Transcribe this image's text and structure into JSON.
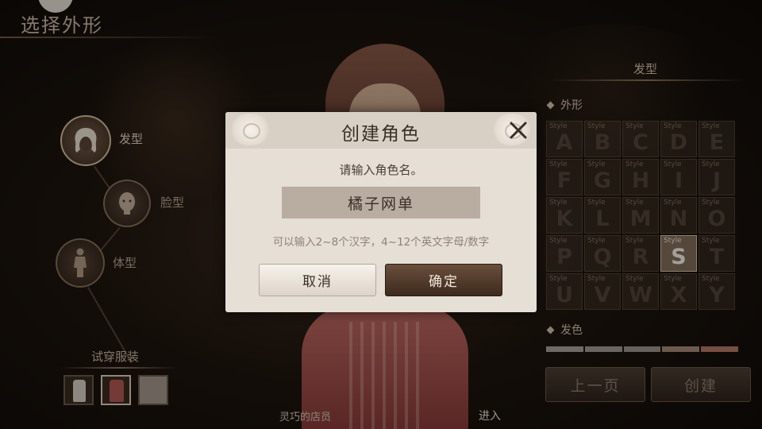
{
  "screen": {
    "title": "选择外形",
    "nav": {
      "hair_label": "发型",
      "face_label": "脸型",
      "body_label": "体型"
    },
    "outfit": {
      "title": "试穿服装"
    },
    "right_panel": {
      "heading": "发型",
      "section_appearance": "外形",
      "section_hair_color": "发色",
      "style_caption": "Style",
      "styles": [
        "A",
        "B",
        "C",
        "D",
        "E",
        "F",
        "G",
        "H",
        "I",
        "J",
        "K",
        "L",
        "M",
        "N",
        "O",
        "P",
        "Q",
        "R",
        "S",
        "T",
        "U",
        "V",
        "W",
        "X",
        "Y"
      ],
      "selected_style": "S",
      "hair_colors": [
        "#a9a39c",
        "#a49c95",
        "#9f948c",
        "#a88a7a",
        "#b47a66"
      ],
      "prev_page_label": "上一页",
      "create_label": "创建"
    },
    "bottom": {
      "left_text": "灵巧的店员",
      "right_text": "进入"
    }
  },
  "dialog": {
    "title": "创建角色",
    "prompt": "请输入角色名。",
    "name_value": "橘子网单",
    "hint": "可以输入2~8个汉字，4~12个英文字母/数字",
    "cancel_label": "取消",
    "confirm_label": "确定"
  }
}
